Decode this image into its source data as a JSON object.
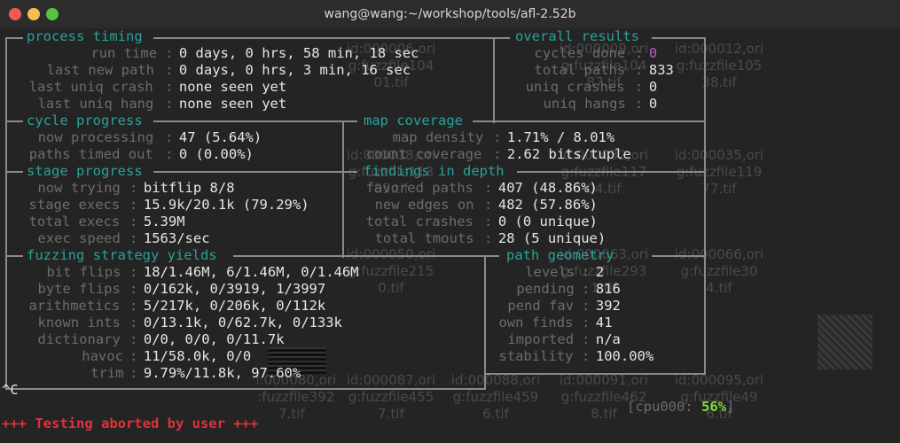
{
  "window": {
    "title": "wang@wang:~/workshop/tools/afl-2.52b"
  },
  "background_files": [
    {
      "l1": "id:000006,ori",
      "l2": "g:fuzzfile104",
      "l3": "01.tif"
    },
    {
      "l1": "id:000009,ori",
      "l2": "g:fuzzfile104",
      "l3": "87.tif"
    },
    {
      "l1": "id:000012,ori",
      "l2": "g:fuzzfile105",
      "l3": "38.tif"
    },
    {
      "l1": "id:000018,ori",
      "l2": "g:fuzzfile113",
      "l3": "85.tif"
    },
    {
      "l1": "id:000032,ori",
      "l2": "g:fuzzfile117",
      "l3": "04.tif"
    },
    {
      "l1": "id:000035,ori",
      "l2": "g:fuzzfile119",
      "l3": "77.tif"
    },
    {
      "l1": "id:000050,ori",
      "l2": "g:fuzzfile215",
      "l3": "0.tif"
    },
    {
      "l1": "id:000063,ori",
      "l2": "g:fuzzfile293",
      "l3": "1.tif"
    },
    {
      "l1": "id:000066,ori",
      "l2": "g:fuzzfile30",
      "l3": "4.tif"
    },
    {
      "l1": "id:000080,ori",
      "l2": "g:fuzzfile392",
      "l3": "7.tif"
    },
    {
      "l1": "id:000087,ori",
      "l2": "g:fuzzfile455",
      "l3": "7.tif"
    },
    {
      "l1": "id:000088,ori",
      "l2": "g:fuzzfile459",
      "l3": "6.tif"
    },
    {
      "l1": "id:000091,ori",
      "l2": "g:fuzzfile462",
      "l3": "8.tif"
    },
    {
      "l1": "id:000095,ori",
      "l2": "g:fuzzfile49",
      "l3": "6.tif"
    }
  ],
  "sections": {
    "process_timing": "process timing",
    "overall_results": "overall results",
    "cycle_progress": "cycle progress",
    "map_coverage": "map coverage",
    "stage_progress": "stage progress",
    "findings_in_depth": "findings in depth",
    "fuzzing_strategy_yields": "fuzzing strategy yields",
    "path_geometry": "path geometry"
  },
  "process_timing": {
    "run_time": {
      "label": "run time",
      "value": "0 days, 0 hrs, 58 min, 18 sec"
    },
    "last_new_path": {
      "label": "last new path",
      "value": "0 days, 0 hrs, 3 min, 16 sec"
    },
    "last_uniq_crash": {
      "label": "last uniq crash",
      "value": "none seen yet"
    },
    "last_uniq_hang": {
      "label": "last uniq hang",
      "value": "none seen yet"
    }
  },
  "overall_results": {
    "cycles_done": {
      "label": "cycles done",
      "value": "0"
    },
    "total_paths": {
      "label": "total paths",
      "value": "833"
    },
    "uniq_crashes": {
      "label": "uniq crashes",
      "value": "0"
    },
    "uniq_hangs": {
      "label": "uniq hangs",
      "value": "0"
    }
  },
  "cycle_progress": {
    "now_processing": {
      "label": "now processing",
      "value": "47 (5.64%)"
    },
    "paths_timed_out": {
      "label": "paths timed out",
      "value": "0 (0.00%)"
    }
  },
  "map_coverage": {
    "map_density": {
      "label": "map density",
      "value": "1.71% / 8.01%"
    },
    "count_coverage": {
      "label": "count coverage",
      "value": "2.62 bits/tuple"
    }
  },
  "stage_progress": {
    "now_trying": {
      "label": "now trying",
      "value": "bitflip 8/8"
    },
    "stage_execs": {
      "label": "stage execs",
      "value": "15.9k/20.1k (79.29%)"
    },
    "total_execs": {
      "label": "total execs",
      "value": "5.39M"
    },
    "exec_speed": {
      "label": "exec speed",
      "value": "1563/sec"
    }
  },
  "findings_in_depth": {
    "favored_paths": {
      "label": "favored paths",
      "value": "407 (48.86%)"
    },
    "new_edges_on": {
      "label": "new edges on",
      "value": "482 (57.86%)"
    },
    "total_crashes": {
      "label": "total crashes",
      "value": "0 (0 unique)"
    },
    "total_tmouts": {
      "label": "total tmouts",
      "value": "28 (5 unique)"
    }
  },
  "fuzzing_strategy_yields": {
    "bit_flips": {
      "label": "bit flips",
      "value": "18/1.46M, 6/1.46M, 0/1.46M"
    },
    "byte_flips": {
      "label": "byte flips",
      "value": "0/162k, 0/3919, 1/3997"
    },
    "arithmetics": {
      "label": "arithmetics",
      "value": "5/217k, 0/206k, 0/112k"
    },
    "known_ints": {
      "label": "known ints",
      "value": "0/13.1k, 0/62.7k, 0/133k"
    },
    "dictionary": {
      "label": "dictionary",
      "value": "0/0, 0/0, 0/11.7k"
    },
    "havoc": {
      "label": "havoc",
      "value": "11/58.0k, 0/0"
    },
    "trim": {
      "label": "trim",
      "value": "9.79%/11.8k, 97.60%"
    }
  },
  "path_geometry": {
    "levels": {
      "label": "levels",
      "value": "2"
    },
    "pending": {
      "label": "pending",
      "value": "816"
    },
    "pend_fav": {
      "label": "pend fav",
      "value": "392"
    },
    "own_finds": {
      "label": "own finds",
      "value": "41"
    },
    "imported": {
      "label": "imported",
      "value": "n/a"
    },
    "stability": {
      "label": "stability",
      "value": "100.00%"
    }
  },
  "cpu": {
    "label": "[cpu000:",
    "value": "56%",
    "close": "]"
  },
  "interrupt": "^C",
  "abort_message": "+++ Testing aborted by user +++"
}
